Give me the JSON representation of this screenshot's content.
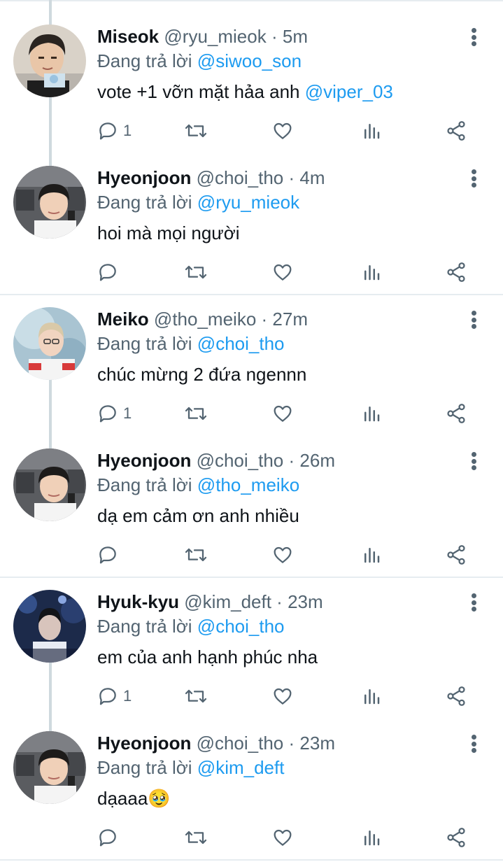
{
  "reply_prefix": "Đang trả lời",
  "colors": {
    "accent": "#1d9bf0",
    "text": "#0f1419",
    "muted": "#536471",
    "divider": "#e6ecf0",
    "connector": "#cfd9de"
  },
  "icons": [
    "reply-icon",
    "retweet-icon",
    "like-icon",
    "stats-icon",
    "share-icon",
    "more-icon"
  ],
  "threads": [
    {
      "tweets": [
        {
          "name": "Miseok",
          "handle": "@ryu_mieok",
          "time": "5m",
          "reply_to": "@siwoo_son",
          "text_parts": [
            "vote +1 vỡn mặt hảa anh ",
            "@viper_03"
          ],
          "reply_count": "1"
        },
        {
          "name": "Hyeonjoon",
          "handle": "@choi_tho",
          "time": "4m",
          "reply_to": "@ryu_mieok",
          "text_parts": [
            "hoi mà mọi người",
            ""
          ],
          "reply_count": ""
        }
      ]
    },
    {
      "tweets": [
        {
          "name": "Meiko",
          "handle": "@tho_meiko",
          "time": "27m",
          "reply_to": "@choi_tho",
          "text_parts": [
            "chúc mừng 2 đứa ngennn",
            ""
          ],
          "reply_count": "1"
        },
        {
          "name": "Hyeonjoon",
          "handle": "@choi_tho",
          "time": "26m",
          "reply_to": "@tho_meiko",
          "text_parts": [
            "dạ em cảm ơn anh nhiều",
            ""
          ],
          "reply_count": ""
        }
      ]
    },
    {
      "tweets": [
        {
          "name": "Hyuk-kyu",
          "handle": "@kim_deft",
          "time": "23m",
          "reply_to": "@choi_tho",
          "text_parts": [
            "em của anh hạnh phúc nha",
            ""
          ],
          "reply_count": "1"
        },
        {
          "name": "Hyeonjoon",
          "handle": "@choi_tho",
          "time": "23m",
          "reply_to": "@kim_deft",
          "text_parts": [
            "dạaaa🥹",
            ""
          ],
          "reply_count": ""
        }
      ]
    }
  ]
}
